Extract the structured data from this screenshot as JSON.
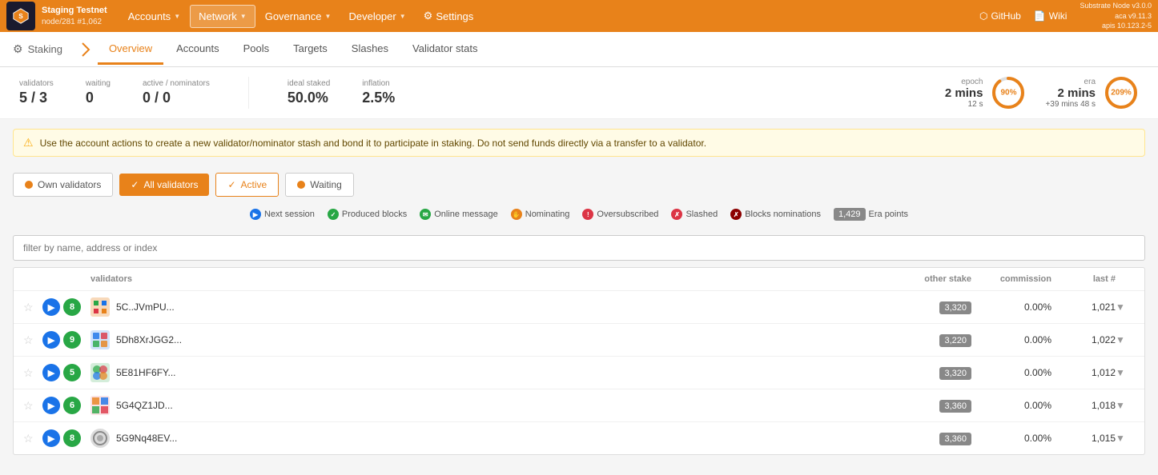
{
  "topnav": {
    "node_name": "Staging Testnet",
    "node_id": "node/281 #1,062",
    "nav_items": [
      {
        "label": "Accounts",
        "has_chevron": true
      },
      {
        "label": "Network",
        "has_chevron": true,
        "active": true
      },
      {
        "label": "Governance",
        "has_chevron": true
      },
      {
        "label": "Developer",
        "has_chevron": true
      },
      {
        "label": "Settings",
        "has_chevron": false
      }
    ],
    "right_links": [
      {
        "label": "GitHub",
        "icon": "github-icon"
      },
      {
        "label": "Wiki",
        "icon": "wiki-icon"
      }
    ],
    "version_info": "Substrate Node v3.0.0\naca v9.11.3\napis 10.123.2-5"
  },
  "subnav": {
    "staking_label": "Staking",
    "tabs": [
      {
        "label": "Overview",
        "active": true
      },
      {
        "label": "Accounts"
      },
      {
        "label": "Pools"
      },
      {
        "label": "Targets"
      },
      {
        "label": "Slashes"
      },
      {
        "label": "Validator stats"
      }
    ]
  },
  "stats": {
    "validators_label": "validators",
    "validators_value": "5 / 3",
    "waiting_label": "waiting",
    "waiting_value": "0",
    "active_nominators_label": "active / nominators",
    "active_nominators_value": "0 / 0",
    "ideal_staked_label": "ideal staked",
    "ideal_staked_value": "50.0%",
    "inflation_label": "inflation",
    "inflation_value": "2.5%",
    "epoch_label": "epoch",
    "epoch_time": "2 mins",
    "epoch_sub": "12 s",
    "epoch_pct": "90%",
    "epoch_pct_num": 90,
    "era_label": "era",
    "era_time": "2 mins",
    "era_sub": "+39 mins 48 s",
    "era_pct": "209%",
    "era_pct_num": 100
  },
  "alert": {
    "message": "Use the account actions to create a new validator/nominator stash and bond it to participate in staking. Do not send funds directly via a transfer to a validator."
  },
  "buttons": {
    "own_validators": "Own validators",
    "all_validators": "All validators",
    "active": "Active",
    "waiting": "Waiting"
  },
  "legend": {
    "items": [
      {
        "label": "Next session",
        "color": "#1a73e8",
        "symbol": "▶"
      },
      {
        "label": "Produced blocks",
        "color": "#28a745",
        "symbol": "✓"
      },
      {
        "label": "Online message",
        "color": "#28a745",
        "symbol": "✉"
      },
      {
        "label": "Nominating",
        "color": "#e8821a",
        "symbol": "✋"
      },
      {
        "label": "Oversubscribed",
        "color": "#dc3545",
        "symbol": "!"
      },
      {
        "label": "Slashed",
        "color": "#dc3545",
        "symbol": "✗"
      },
      {
        "label": "Blocks nominations",
        "color": "#dc3545",
        "symbol": "✗"
      },
      {
        "label": "Era points",
        "value": "1,429"
      }
    ]
  },
  "filter": {
    "placeholder": "filter by name, address or index"
  },
  "table": {
    "headers": {
      "validators": "validators",
      "other_stake": "other stake",
      "commission": "commission",
      "last_hash": "last #"
    },
    "rows": [
      {
        "id": "row-1",
        "actions": [
          {
            "icon": "▶",
            "color": "blue"
          },
          {
            "num": "8",
            "color": "green"
          }
        ],
        "name": "5C..JVmPU...",
        "era_badge": "3,320",
        "commission": "0.00%",
        "last": "1,021"
      },
      {
        "id": "row-2",
        "actions": [
          {
            "icon": "▶",
            "color": "blue"
          },
          {
            "num": "9",
            "color": "green"
          }
        ],
        "name": "5Dh8XrJGG2...",
        "era_badge": "3,220",
        "commission": "0.00%",
        "last": "1,022"
      },
      {
        "id": "row-3",
        "actions": [
          {
            "icon": "▶",
            "color": "blue"
          },
          {
            "num": "5",
            "color": "green"
          }
        ],
        "name": "5E81HF6FY...",
        "era_badge": "3,320",
        "commission": "0.00%",
        "last": "1,012"
      },
      {
        "id": "row-4",
        "actions": [
          {
            "icon": "▶",
            "color": "blue"
          },
          {
            "num": "6",
            "color": "green"
          }
        ],
        "name": "5G4QZ1JD...",
        "era_badge": "3,360",
        "commission": "0.00%",
        "last": "1,018"
      },
      {
        "id": "row-5",
        "actions": [
          {
            "icon": "▶",
            "color": "blue"
          },
          {
            "num": "8",
            "color": "green"
          }
        ],
        "name": "5G9Nq48EV...",
        "era_badge": "3,360",
        "commission": "0.00%",
        "last": "1,015"
      }
    ]
  }
}
